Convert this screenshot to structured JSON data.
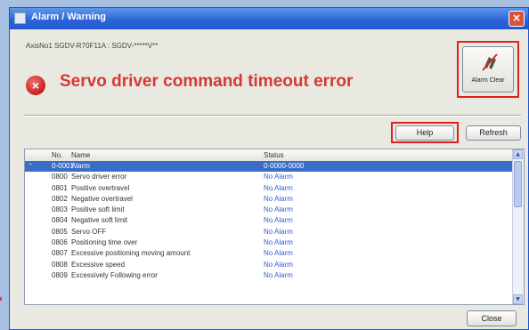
{
  "window": {
    "title": "Alarm / Warning",
    "close_glyph": "×"
  },
  "header": {
    "model_line": "AxisNo1 SGDV-R70F11A : SGDV-*****V**",
    "error_glyph": "×",
    "error_title": "Servo driver command timeout error"
  },
  "toolbar": {
    "alarm_clear_label": "Alarm Clear",
    "help_label": "Help",
    "refresh_label": "Refresh",
    "close_label": "Close"
  },
  "table": {
    "columns": [
      "No.",
      "Name",
      "Status"
    ],
    "rows": [
      {
        "exp": "−",
        "no": "0-0001",
        "name": "Alarm",
        "status": "0-0000-0000"
      },
      {
        "exp": "",
        "no": "0800",
        "name": "Servo driver error",
        "status": "No Alarm"
      },
      {
        "exp": "",
        "no": "0801",
        "name": "Positive overtravel",
        "status": "No Alarm"
      },
      {
        "exp": "",
        "no": "0802",
        "name": "Negative overtravel",
        "status": "No Alarm"
      },
      {
        "exp": "",
        "no": "0803",
        "name": "Positive soft limit",
        "status": "No Alarm"
      },
      {
        "exp": "",
        "no": "0804",
        "name": "Negative soft limit",
        "status": "No Alarm"
      },
      {
        "exp": "",
        "no": "0805",
        "name": "Servo OFF",
        "status": "No Alarm"
      },
      {
        "exp": "",
        "no": "0806",
        "name": "Positioning time over",
        "status": "No Alarm"
      },
      {
        "exp": "",
        "no": "0807",
        "name": "Excessive positioning moving amount",
        "status": "No Alarm"
      },
      {
        "exp": "",
        "no": "0808",
        "name": "Excessive speed",
        "status": "No Alarm"
      },
      {
        "exp": "",
        "no": "0809",
        "name": "Excessively Following error",
        "status": "No Alarm"
      }
    ],
    "selected_index": 0
  },
  "icons": {
    "window": "window-icon",
    "close": "close-icon",
    "error": "error-icon",
    "alarm_clear": "alarm-clear-icon"
  },
  "colors": {
    "error_red": "#d43a33",
    "highlight_red": "#e0201a",
    "selection_blue": "#3a6dc8",
    "status_blue": "#2f5fd0"
  }
}
